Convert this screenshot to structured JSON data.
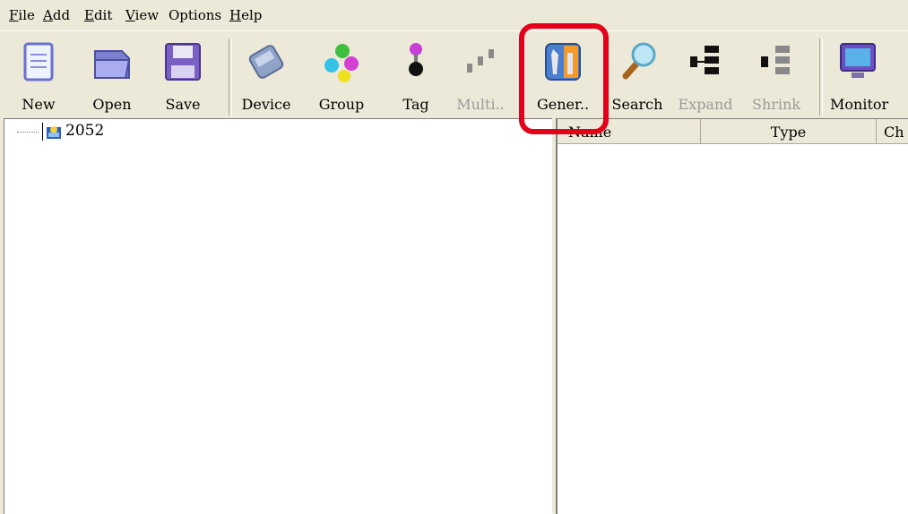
{
  "menu": {
    "file": {
      "u": "F",
      "rest": "ile"
    },
    "add": {
      "u": "A",
      "rest": "dd"
    },
    "edit": {
      "u": "E",
      "rest": "dit"
    },
    "view": {
      "u": "V",
      "rest": "iew"
    },
    "options": {
      "u": "",
      "rest": "Options"
    },
    "help": {
      "u": "H",
      "rest": "elp"
    }
  },
  "toolbar": {
    "new_label": "New",
    "open_label": "Open",
    "save_label": "Save",
    "device_label": "Device",
    "group_label": "Group",
    "tag_label": "Tag",
    "multi_label": "Multi..",
    "general_label": "Gener..",
    "search_label": "Search",
    "expand_label": "Expand",
    "shrink_label": "Shrink",
    "monitor_label": "Monitor"
  },
  "tree": {
    "root_label": "2052"
  },
  "list": {
    "columns": [
      "Name",
      "Type",
      "Ch"
    ]
  },
  "colors": {
    "highlight": "#e3001a",
    "disabled_text": "#9a9a9a"
  }
}
